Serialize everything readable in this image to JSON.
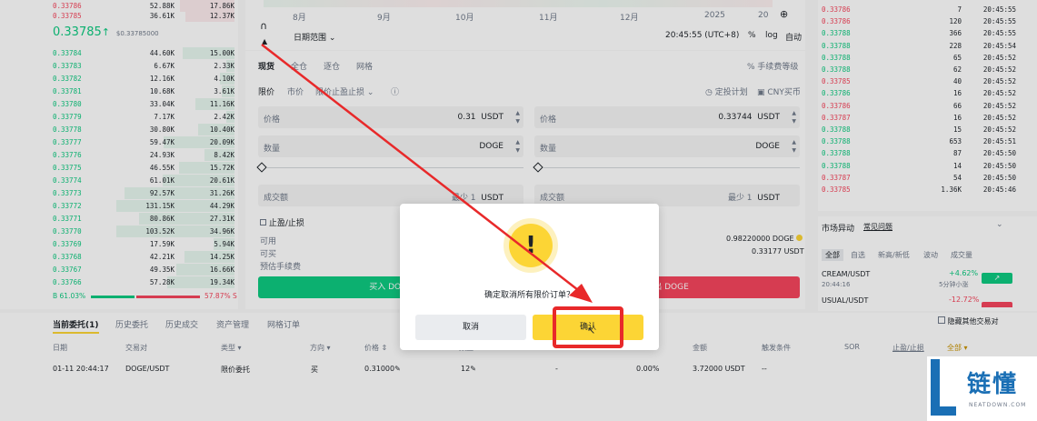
{
  "orderbook": {
    "top_rows": [
      {
        "price": "0.33786",
        "amount": "52.88K",
        "total": "17.86K"
      },
      {
        "price": "0.33785",
        "amount": "36.61K",
        "total": "12.37K"
      }
    ],
    "last_price": "0.33785",
    "last_price_arrow": "↑",
    "last_price_usd": "$0.33785000",
    "bid_rows": [
      {
        "price": "0.33784",
        "amount": "44.60K",
        "total": "15.00K"
      },
      {
        "price": "0.33783",
        "amount": "6.67K",
        "total": "2.33K"
      },
      {
        "price": "0.33782",
        "amount": "12.16K",
        "total": "4.10K"
      },
      {
        "price": "0.33781",
        "amount": "10.68K",
        "total": "3.61K"
      },
      {
        "price": "0.33780",
        "amount": "33.04K",
        "total": "11.16K"
      },
      {
        "price": "0.33779",
        "amount": "7.17K",
        "total": "2.42K"
      },
      {
        "price": "0.33778",
        "amount": "30.80K",
        "total": "10.40K"
      },
      {
        "price": "0.33777",
        "amount": "59.47K",
        "total": "20.09K"
      },
      {
        "price": "0.33776",
        "amount": "24.93K",
        "total": "8.42K"
      },
      {
        "price": "0.33775",
        "amount": "46.55K",
        "total": "15.72K"
      },
      {
        "price": "0.33774",
        "amount": "61.01K",
        "total": "20.61K"
      },
      {
        "price": "0.33773",
        "amount": "92.57K",
        "total": "31.26K"
      },
      {
        "price": "0.33772",
        "amount": "131.15K",
        "total": "44.29K"
      },
      {
        "price": "0.33771",
        "amount": "80.86K",
        "total": "27.31K"
      },
      {
        "price": "0.33770",
        "amount": "103.52K",
        "total": "34.96K"
      },
      {
        "price": "0.33769",
        "amount": "17.59K",
        "total": "5.94K"
      },
      {
        "price": "0.33768",
        "amount": "42.21K",
        "total": "14.25K"
      },
      {
        "price": "0.33767",
        "amount": "49.35K",
        "total": "16.66K"
      },
      {
        "price": "0.33766",
        "amount": "57.28K",
        "total": "19.34K"
      }
    ],
    "bid_fill": [
      0.44,
      0.07,
      0.12,
      0.11,
      0.33,
      0.07,
      0.31,
      0.6,
      0.25,
      0.47,
      0.61,
      0.93,
      1.0,
      0.81,
      1.0,
      0.18,
      0.42,
      0.49,
      0.57
    ],
    "ratio_buy": "B 61.03%",
    "ratio_sell": "57.87% S"
  },
  "chart": {
    "months": [
      "8月",
      "9月",
      "10月",
      "11月",
      "12月",
      "2025"
    ],
    "zoom_value": "20",
    "range_label": "日期范围 ⌄",
    "time": "20:45:55 (UTC+8)",
    "percent_label": "%",
    "log_label": "log",
    "auto_label": "自动"
  },
  "trade": {
    "tabs": [
      "现货",
      "全仓",
      "逐仓",
      "网格"
    ],
    "fee_label": "% 手续费等级",
    "order_types": [
      "限价",
      "市价",
      "限价止盈止损 ⌄"
    ],
    "info_icon": "info-circle-icon",
    "auto_invest": "定投计划",
    "cny_label": "CNY买币",
    "buy": {
      "price_label": "价格",
      "price_value": "0.31",
      "price_unit": "USDT",
      "qty_label": "数量",
      "qty_unit": "DOGE",
      "total_label": "成交额",
      "total_min": "最少 1",
      "total_unit": "USDT",
      "tpsl_label": "止盈/止损",
      "avail_label": "可用",
      "avail_value": "",
      "max_label": "可买",
      "fee_label": "预估手续费",
      "button": "买入 DOGE"
    },
    "sell": {
      "price_label": "价格",
      "price_value": "0.33744",
      "price_unit": "USDT",
      "qty_label": "数量",
      "qty_unit": "DOGE",
      "total_label": "成交额",
      "total_min": "最少 1",
      "total_unit": "USDT",
      "avail_value": "0.98220000 DOGE",
      "max_value": "0.33177 USDT",
      "button": "卖出 DOGE"
    }
  },
  "trades": {
    "rows": [
      {
        "price": "0.33786",
        "amount": "7",
        "time": "20:45:55",
        "color": "red"
      },
      {
        "price": "0.33786",
        "amount": "120",
        "time": "20:45:55",
        "color": "red"
      },
      {
        "price": "0.33788",
        "amount": "366",
        "time": "20:45:55",
        "color": "green"
      },
      {
        "price": "0.33788",
        "amount": "228",
        "time": "20:45:54",
        "color": "green"
      },
      {
        "price": "0.33788",
        "amount": "65",
        "time": "20:45:52",
        "color": "green"
      },
      {
        "price": "0.33788",
        "amount": "62",
        "time": "20:45:52",
        "color": "green"
      },
      {
        "price": "0.33785",
        "amount": "40",
        "time": "20:45:52",
        "color": "red"
      },
      {
        "price": "0.33786",
        "amount": "16",
        "time": "20:45:52",
        "color": "green"
      },
      {
        "price": "0.33786",
        "amount": "66",
        "time": "20:45:52",
        "color": "red"
      },
      {
        "price": "0.33787",
        "amount": "16",
        "time": "20:45:52",
        "color": "red"
      },
      {
        "price": "0.33788",
        "amount": "15",
        "time": "20:45:52",
        "color": "green"
      },
      {
        "price": "0.33788",
        "amount": "653",
        "time": "20:45:51",
        "color": "green"
      },
      {
        "price": "0.33788",
        "amount": "87",
        "time": "20:45:50",
        "color": "green"
      },
      {
        "price": "0.33788",
        "amount": "14",
        "time": "20:45:50",
        "color": "green"
      },
      {
        "price": "0.33787",
        "amount": "54",
        "time": "20:45:50",
        "color": "red"
      },
      {
        "price": "0.33785",
        "amount": "1.36K",
        "time": "20:45:46",
        "color": "red"
      }
    ]
  },
  "market_moves": {
    "title": "市场异动",
    "faq": "常见问题",
    "tabs": [
      "全部",
      "自选",
      "新高/新低",
      "波动",
      "成交量"
    ],
    "items": [
      {
        "pair": "CREAM/USDT",
        "time": "20:44:16",
        "change": "+4.62%",
        "desc": "5分钟小涨",
        "color": "green"
      },
      {
        "pair": "USUAL/USDT",
        "time": "",
        "change": "-12.72%",
        "desc": "",
        "color": "red"
      }
    ]
  },
  "orders": {
    "tabs": [
      "当前委托(1)",
      "历史委托",
      "历史成交",
      "资产管理",
      "网格订单"
    ],
    "hide_others": "隐藏其他交易对",
    "columns": [
      "日期",
      "交易对",
      "类型 ▾",
      "方向 ▾",
      "价格 ⇕",
      "数量 ⇕",
      "",
      "",
      "金额",
      "触发条件",
      "SOR",
      "止盈/止损",
      "全部 ▾"
    ],
    "row": {
      "date": "01-11 20:44:17",
      "pair": "DOGE/USDT",
      "type": "限价委托",
      "side": "买",
      "price": "0.31000",
      "qty": "12",
      "filled": "-",
      "percent": "0.00%",
      "amount": "3.72000 USDT",
      "trigger": "--"
    }
  },
  "dialog": {
    "icon": "!",
    "message": "确定取消所有限价订单？",
    "cancel": "取消",
    "confirm": "确认"
  },
  "logo": {
    "brand": "链懂",
    "site": "NEATDOWN.COM"
  },
  "colors": {
    "green": "#0ecb81",
    "red": "#f6465d",
    "yellow": "#fcd535",
    "annotation_red": "#e8292a"
  }
}
